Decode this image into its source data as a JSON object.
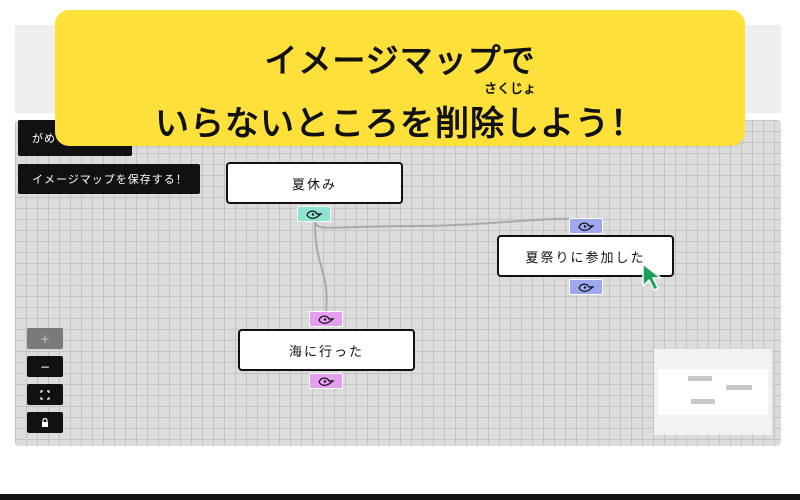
{
  "banner": {
    "line1": "イメージマップで",
    "ruby": "さくじょ",
    "line2": "いらないところを削除しよう！"
  },
  "toolbar": {
    "partial_button_label": "がめ",
    "save_button_label": "イメージマップを保存する！"
  },
  "nodes": {
    "summer": "夏休み",
    "festival": "夏祭りに参加した",
    "sea": "海に行った"
  },
  "controls": {
    "zoom_in": "+",
    "zoom_out": "−",
    "fit_view": "⛶",
    "lock": "🔒"
  },
  "colors": {
    "banner": "#fde03a",
    "handle_teal": "#8fe3d3",
    "handle_blue": "#9ea8f0",
    "handle_pink": "#e69ef0",
    "cursor": "#1aa05a"
  }
}
